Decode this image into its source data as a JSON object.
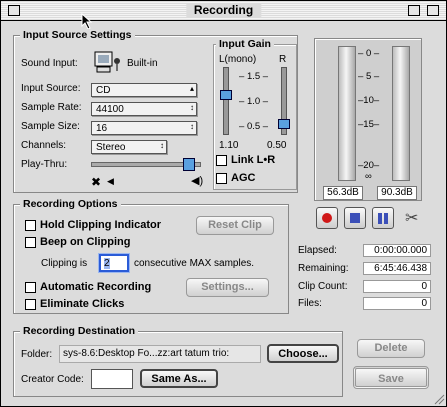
{
  "window": {
    "title": "Recording"
  },
  "input_source": {
    "group_title": "Input Source Settings",
    "sound_input_label": "Sound Input:",
    "sound_input_value": "Built-in",
    "input_source_label": "Input Source:",
    "input_source_value": "CD",
    "sample_rate_label": "Sample Rate:",
    "sample_rate_value": "44100",
    "sample_size_label": "Sample Size:",
    "sample_size_value": "16",
    "channels_label": "Channels:",
    "channels_value": "Stereo",
    "play_thru_label": "Play-Thru:",
    "play_thru_level": 0.95
  },
  "input_gain": {
    "title": "Input Gain",
    "l_label": "L(mono)",
    "r_label": "R",
    "ticks": [
      "1.5",
      "1.0",
      "0.5"
    ],
    "l_value": "1.10",
    "r_value": "0.50",
    "link_label": "Link L•R",
    "agc_label": "AGC"
  },
  "meters": {
    "ticks": [
      "0",
      "5",
      "10",
      "15",
      "20",
      "∞"
    ],
    "left_readout": "56.3dB",
    "right_readout": "90.3dB"
  },
  "recording_options": {
    "group_title": "Recording Options",
    "hold_clipping_label": "Hold Clipping Indicator",
    "reset_clip_label": "Reset Clip",
    "beep_on_clipping_label": "Beep on Clipping",
    "clipping_is_label": "Clipping is",
    "clipping_value": "2",
    "clipping_suffix": "consecutive MAX samples.",
    "automatic_recording_label": "Automatic Recording",
    "settings_label": "Settings...",
    "eliminate_clicks_label": "Eliminate Clicks"
  },
  "stats": {
    "elapsed_label": "Elapsed:",
    "elapsed_value": "0:00:00.000",
    "remaining_label": "Remaining:",
    "remaining_value": "6:45:46.438",
    "clip_count_label": "Clip Count:",
    "clip_count_value": "0",
    "files_label": "Files:",
    "files_value": "0"
  },
  "destination": {
    "group_title": "Recording Destination",
    "folder_label": "Folder:",
    "folder_value": "sys-8.6:Desktop Fo...zz:art tatum trio:",
    "choose_label": "Choose...",
    "creator_code_label": "Creator Code:",
    "creator_code_value": "",
    "same_as_label": "Same As..."
  },
  "actions": {
    "delete_label": "Delete",
    "save_label": "Save"
  }
}
